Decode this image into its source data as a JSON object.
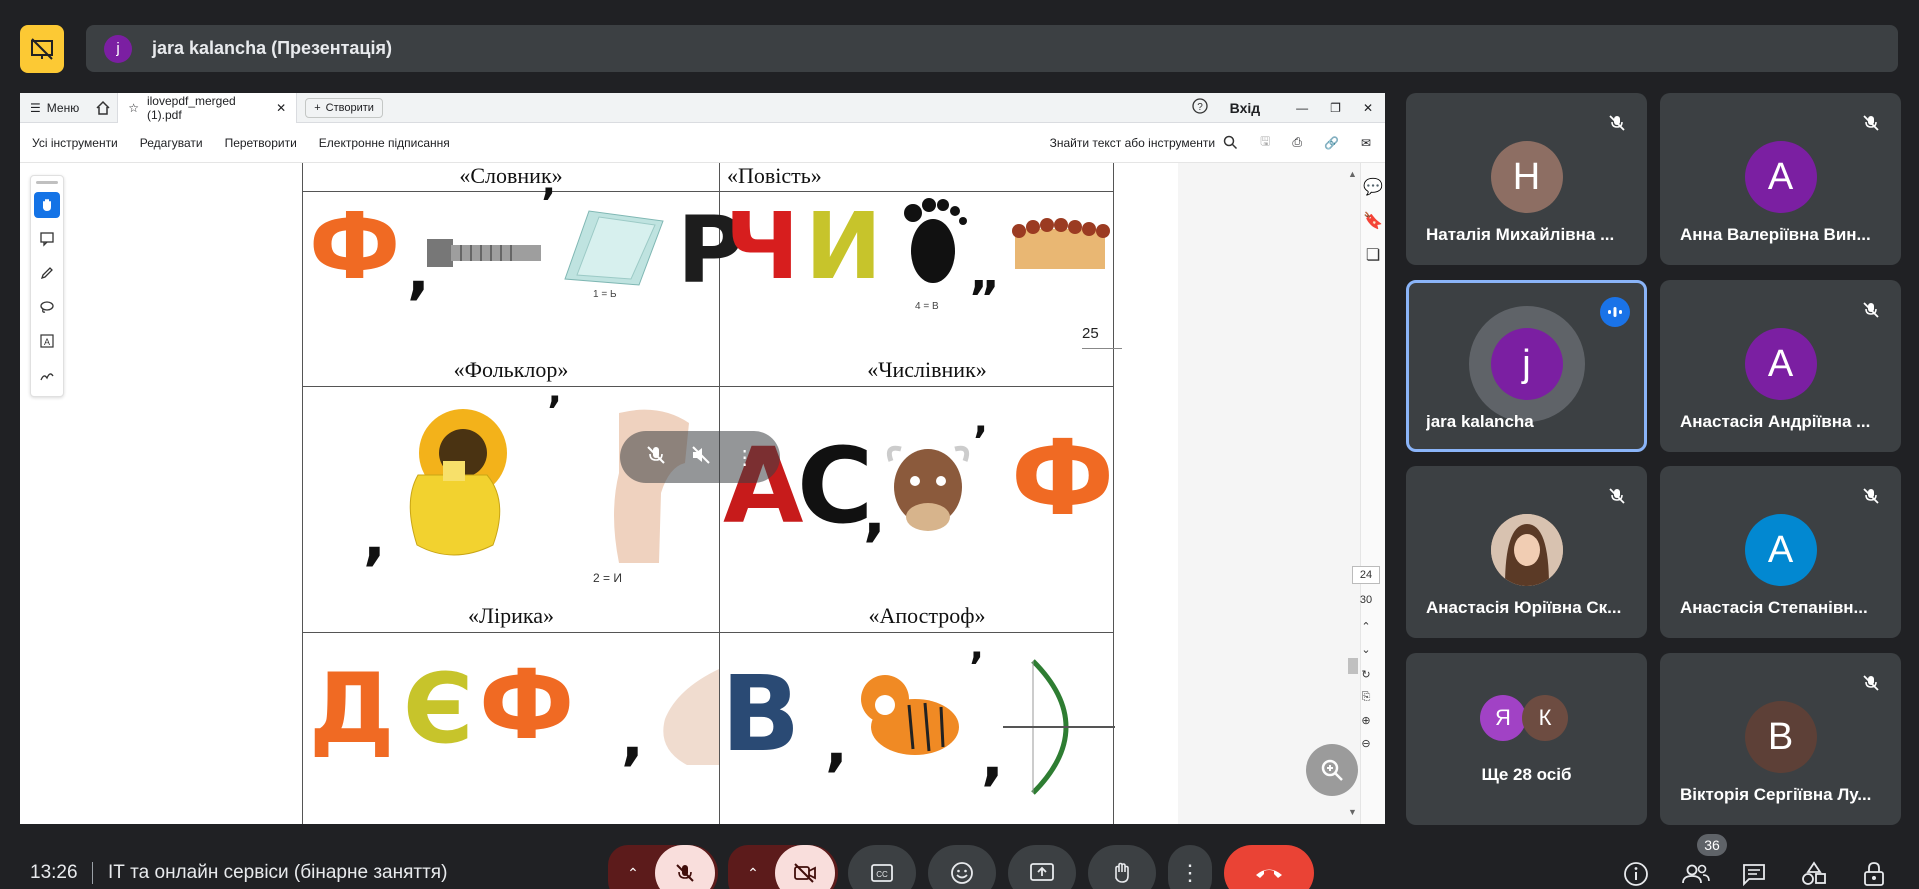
{
  "presenter": {
    "initial": "j",
    "name": "jara kalancha (Презентація)"
  },
  "pdf": {
    "menu_label": "Меню",
    "doc_tab_label": "ilovepdf_merged (1).pdf",
    "create_label": "Створити",
    "sign_in_label": "Вхід",
    "toolbar": [
      "Усі інструменти",
      "Редагувати",
      "Перетворити",
      "Електронне підписання"
    ],
    "find_label": "Знайти текст або інструменти",
    "page_label": "25",
    "page_indicator_current": "24",
    "page_indicator_total": "30",
    "cells": [
      {
        "title": "«Словник»",
        "glyphs": "Ф ,",
        "note": "1 = Ь"
      },
      {
        "title": "«Повість»",
        "glyphs": "Ч И",
        "note": "4 = В"
      },
      {
        "title": "«Фольклор»",
        "glyphs": ",",
        "note": "2 = И"
      },
      {
        "title": "«Числівник»",
        "glyphs": "А С , Ф",
        "note": ""
      },
      {
        "title": "«Лірика»",
        "glyphs": "Д Є Ф ,",
        "note": ""
      },
      {
        "title": "«Апостроф»",
        "glyphs": "В , ,",
        "note": ""
      }
    ]
  },
  "participants": [
    {
      "initial": "Н",
      "name": "Наталія Михайлівна ...",
      "color": "#8d6e63",
      "muted": true
    },
    {
      "initial": "А",
      "name": "Анна Валеріївна Вин...",
      "color": "#7b1fa2",
      "muted": true
    },
    {
      "initial": "j",
      "name": "jara kalancha",
      "color": "#7b1fa2",
      "muted": false,
      "speaking": true
    },
    {
      "initial": "А",
      "name": "Анастасія Андріївна ...",
      "color": "#7b1fa2",
      "muted": true
    },
    {
      "initial": "",
      "name": "Анастасія Юріївна Ск...",
      "color": "#c9a48a",
      "muted": true,
      "photo": true
    },
    {
      "initial": "А",
      "name": "Анастасія Степанівн...",
      "color": "#0288d1",
      "muted": true
    },
    {
      "initial": "",
      "name": "Ще 28 осіб",
      "color": "",
      "muted": false,
      "group": [
        "Я",
        "К"
      ]
    },
    {
      "initial": "В",
      "name": "Вікторія Сергіївна Лу...",
      "color": "#5d4037",
      "muted": true
    }
  ],
  "bottom": {
    "time": "13:26",
    "meeting_title": "ІТ та онлайн сервіси (бінарне заняття)",
    "participant_count": "36"
  },
  "colors": {
    "background": "#202124",
    "tile": "#3c4043",
    "accent_red": "#ea4335",
    "accent_blue": "#8ab4f8"
  }
}
